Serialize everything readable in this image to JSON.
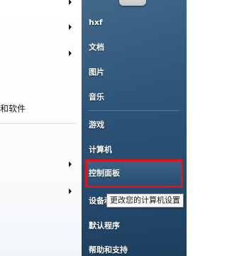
{
  "left_pane": {
    "partial_item": "和软件"
  },
  "right_pane": {
    "items": [
      {
        "label": "hxf"
      },
      {
        "label": "文档"
      },
      {
        "label": "图片"
      },
      {
        "label": "音乐"
      },
      {
        "label": "游戏"
      },
      {
        "label": "计算机"
      },
      {
        "label": "控制面板"
      },
      {
        "label": "设备和打印机"
      },
      {
        "label": "默认程序"
      },
      {
        "label": "帮助和支持"
      }
    ],
    "tooltip": "更改您的计算机设置",
    "highlight_color": "#e0131b"
  }
}
